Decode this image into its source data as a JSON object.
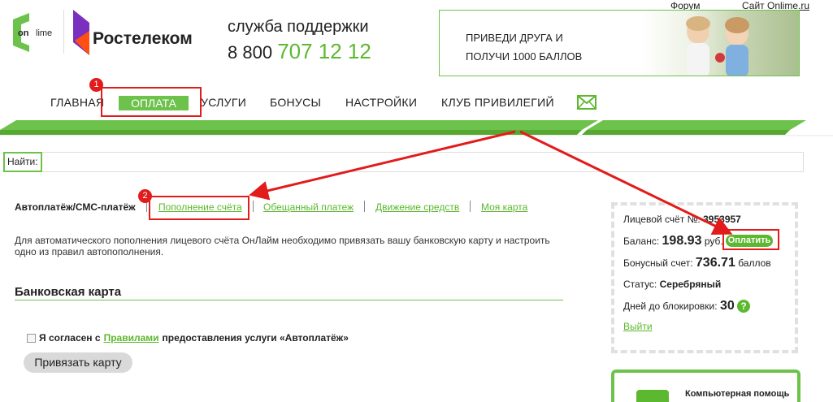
{
  "header": {
    "onlime_logo_text": [
      "on",
      "lime"
    ],
    "rostelecom_logo_text": "Ростелеком",
    "support_label": "служба поддержки",
    "support_prefix": "8 800",
    "support_number": "707 12 12",
    "forum_link": "Форум",
    "site_link": "Сайт Onlime.ru",
    "promo_line1": "ПРИВЕДИ ДРУГА И",
    "promo_line2": "ПОЛУЧИ 1000 БАЛЛОВ"
  },
  "nav": {
    "items": [
      "ГЛАВНАЯ",
      "ОПЛАТА",
      "УСЛУГИ",
      "БОНУСЫ",
      "НАСТРОЙКИ",
      "КЛУБ ПРИВИЛЕГИЙ"
    ],
    "active": "ОПЛАТА",
    "mail_icon": "envelope-icon"
  },
  "search": {
    "label": "Найти:"
  },
  "tabs": {
    "active": "Автоплатёж/СМС-платёж",
    "items": [
      "Пополнение счёта",
      "Обещанный платеж",
      "Движение средств",
      "Моя карта"
    ]
  },
  "content": {
    "description": "Для автоматического пополнения лицевого счёта ОнЛайм необходимо привязать вашу банковскую карту и настроить одно из правил автопополнения.",
    "section_title": "Банковская карта",
    "agree_prefix": "Я согласен с",
    "agree_link": "Правилами",
    "agree_suffix": "предоставления услуги «Автоплатёж»",
    "bind_button": "Привязать карту"
  },
  "account": {
    "account_label": "Лицевой счёт №:",
    "account_number": "3953957",
    "balance_label": "Баланс:",
    "balance_value": "198.93",
    "balance_unit": "руб.",
    "pay_button": "Оплатить",
    "bonus_label": "Бонусный счет:",
    "bonus_value": "736.71",
    "bonus_unit": "баллов",
    "status_label": "Статус:",
    "status_value": "Серебряный",
    "block_label": "Дней до блокировки:",
    "block_value": "30",
    "help_icon": "question-icon",
    "help_icon_glyph": "?",
    "exit_link": "Выйти"
  },
  "help_panel": {
    "title": "Компьютерная помощь"
  },
  "annotations": {
    "badge1": "1",
    "badge2": "2"
  },
  "colors": {
    "brand_green": "#5cb82e",
    "annotation_red": "#e21b1b"
  }
}
